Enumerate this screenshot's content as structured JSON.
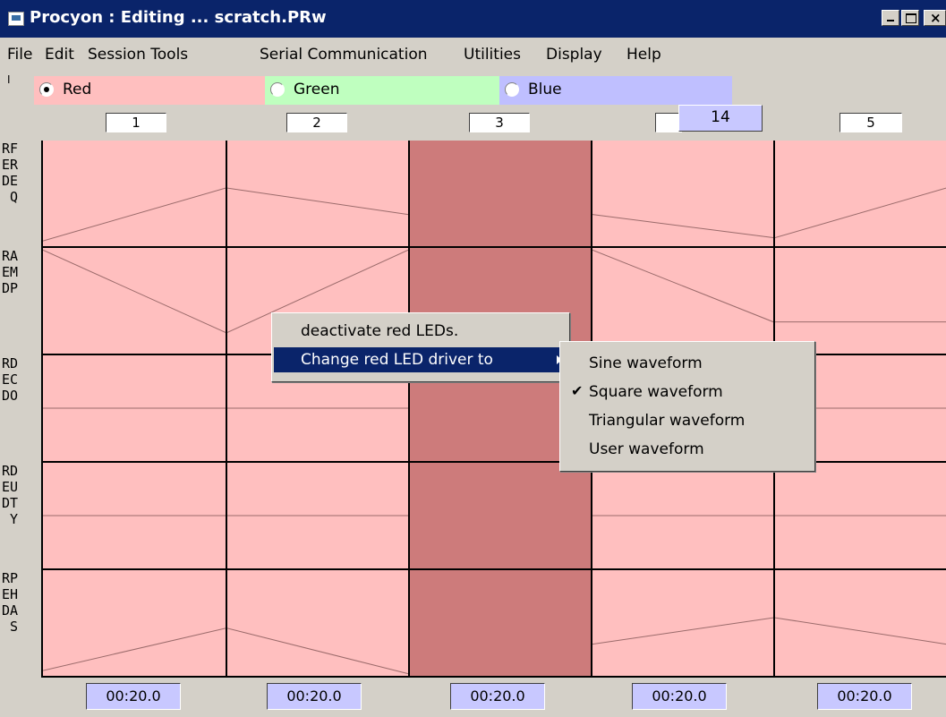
{
  "window": {
    "title": "Procyon : Editing ... scratch.PRw"
  },
  "menubar": [
    "File",
    "Edit",
    "Session Tools",
    "Serial Communication",
    "Utilities",
    "Display",
    "Help"
  ],
  "toolbar": {
    "marker": "I"
  },
  "channels": [
    {
      "label": "Red",
      "checked": true,
      "color": "#ffbfbf"
    },
    {
      "label": "Green",
      "checked": false,
      "color": "#bfffbf"
    },
    {
      "label": "Blue",
      "checked": false,
      "color": "#bfbfff"
    }
  ],
  "columns": {
    "numbers": [
      "1",
      "2",
      "3",
      "",
      "5"
    ],
    "editing_value": "14"
  },
  "rows": [
    {
      "label": "RF\nER\nDE\n Q"
    },
    {
      "label": "RA\nEM\nDP"
    },
    {
      "label": "RD\nEC\nDO"
    },
    {
      "label": "RD\nEU\nDT\n Y"
    },
    {
      "label": "RP\nEH\nDA\n S"
    }
  ],
  "times": [
    "00:20.0",
    "00:20.0",
    "00:20.0",
    "00:20.0",
    "00:20.0"
  ],
  "context_menu": {
    "items": [
      "deactivate red LEDs.",
      "Change red LED driver to"
    ]
  },
  "submenu": {
    "items": [
      "Sine waveform",
      "Square waveform",
      "Triangular waveform",
      "User waveform"
    ],
    "checked_item": "Square waveform",
    "check_mark": "✔"
  },
  "colors": {
    "cell": "#ffbfbf",
    "active_cell": "#cd7b7b",
    "title_bar": "#0a246a",
    "time_box": "#c8c8ff"
  }
}
